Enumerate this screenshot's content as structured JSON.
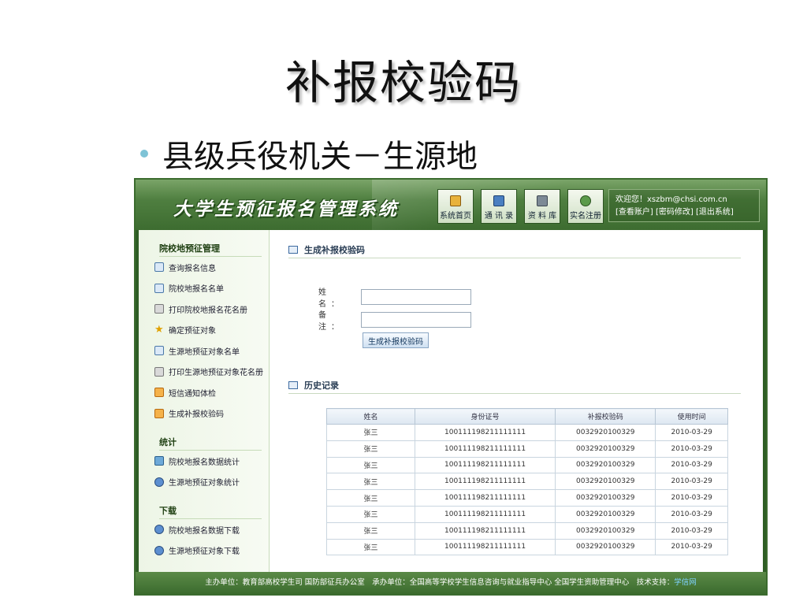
{
  "slide": {
    "title": "补报校验码",
    "bullet": "县级兵役机关－生源地"
  },
  "app": {
    "logo": "大学生预征报名管理系统",
    "nav": [
      {
        "label": "系统首页",
        "icon": "home-icon"
      },
      {
        "label": "通 讯 录",
        "icon": "phone-icon"
      },
      {
        "label": "资 料 库",
        "icon": "database-icon"
      },
      {
        "label": "实名注册",
        "icon": "user-register-icon"
      }
    ],
    "welcome": {
      "text": "欢迎您！xszbm@chsi.com.cn",
      "links": [
        "[查看账户]",
        "[密码修改]",
        "[退出系统]"
      ]
    }
  },
  "sidebar": {
    "groups": [
      {
        "title": "院校地预征管理",
        "items": [
          {
            "label": "查询报名信息",
            "icon": "list-icon"
          },
          {
            "label": "院校地报名名单",
            "icon": "document-icon"
          },
          {
            "label": "打印院校地报名花名册",
            "icon": "printer-icon"
          },
          {
            "label": "确定预征对象",
            "icon": "star-icon"
          },
          {
            "label": "生源地预征对象名单",
            "icon": "document-icon"
          },
          {
            "label": "打印生源地预征对象花名册",
            "icon": "printer-icon"
          },
          {
            "label": "短信通知体检",
            "icon": "message-icon"
          },
          {
            "label": "生成补报校验码",
            "icon": "message-icon"
          }
        ]
      },
      {
        "title": "统计",
        "items": [
          {
            "label": "院校地报名数据统计",
            "icon": "stats-icon"
          },
          {
            "label": "生源地预征对象统计",
            "icon": "people-icon"
          }
        ]
      },
      {
        "title": "下载",
        "items": [
          {
            "label": "院校地报名数据下载",
            "icon": "user-download-icon"
          },
          {
            "label": "生源地预征对象下载",
            "icon": "user-download-icon"
          }
        ]
      }
    ]
  },
  "main": {
    "generate_section_title": "生成补报校验码",
    "name_label": "姓 名：",
    "name_value": "",
    "note_label": "备 注：",
    "note_value": "",
    "generate_button": "生成补报校验码",
    "history_section_title": "历史记录",
    "table": {
      "headers": [
        "姓名",
        "身份证号",
        "补报校验码",
        "使用时间"
      ],
      "rows": [
        [
          "张三",
          "100111198211111111",
          "0032920100329",
          "2010-03-29"
        ],
        [
          "张三",
          "100111198211111111",
          "0032920100329",
          "2010-03-29"
        ],
        [
          "张三",
          "100111198211111111",
          "0032920100329",
          "2010-03-29"
        ],
        [
          "张三",
          "100111198211111111",
          "0032920100329",
          "2010-03-29"
        ],
        [
          "张三",
          "100111198211111111",
          "0032920100329",
          "2010-03-29"
        ],
        [
          "张三",
          "100111198211111111",
          "0032920100329",
          "2010-03-29"
        ],
        [
          "张三",
          "100111198211111111",
          "0032920100329",
          "2010-03-29"
        ],
        [
          "张三",
          "100111198211111111",
          "0032920100329",
          "2010-03-29"
        ]
      ]
    }
  },
  "footer": {
    "text": "主办单位：教育部高校学生司 国防部征兵办公室　承办单位：全国高等学校学生信息咨询与就业指导中心 全国学生资助管理中心　技术支持：",
    "link": "学信网"
  }
}
